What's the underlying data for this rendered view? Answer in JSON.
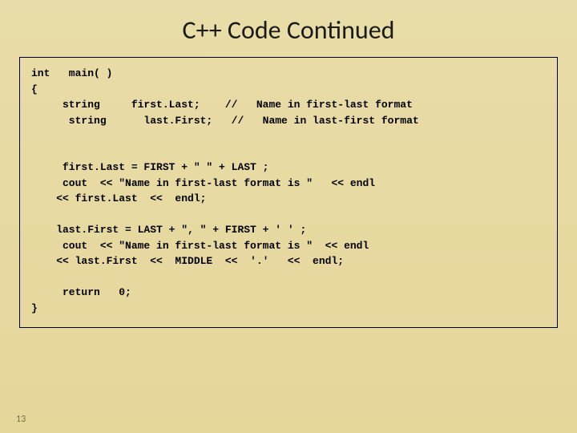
{
  "slide": {
    "title": "C++ Code Continued",
    "code": "int   main( )\n{\n     string     first.Last;    //   Name in first-last format\n      string      last.First;   //   Name in last-first format\n\n\n     first.Last = FIRST + \" \" + LAST ;\n     cout  << \"Name in first-last format is \"   << endl\n    << first.Last  <<  endl;\n\n    last.First = LAST + \", \" + FIRST + ' ' ;\n     cout  << \"Name in first-last format is \"  << endl\n    << last.First  <<  MIDDLE  <<  '.'   <<  endl;\n\n     return   0;\n}",
    "page_number": "13"
  }
}
